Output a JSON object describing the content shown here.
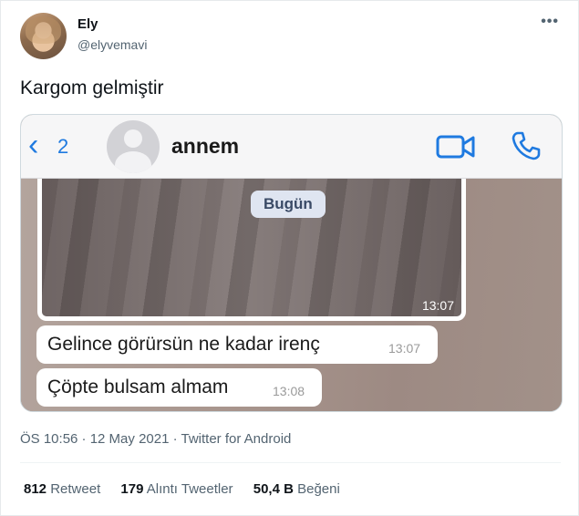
{
  "author": {
    "name": "Ely",
    "handle": "@elyvemavi"
  },
  "more_label": "•••",
  "tweet_text": "Kargom gelmiştir",
  "media": {
    "back_label": "‹",
    "back_count": "2",
    "contact_name": "annem",
    "date_pill": "Bugün",
    "photo_time": "13:07",
    "messages": [
      {
        "text": "Gelince görürsün ne kadar irenç",
        "time": "13:07"
      },
      {
        "text": "Çöpte bulsam almam",
        "time": "13:08"
      }
    ],
    "accent_color": "#1f7ae0"
  },
  "meta": "ÖS 10:56 · 12 May 2021 · Twitter for Android",
  "stats": [
    {
      "num": "812",
      "label": "Retweet"
    },
    {
      "num": "179",
      "label": "Alıntı Tweetler"
    },
    {
      "num": "50,4 B",
      "label": "Beğeni"
    }
  ]
}
